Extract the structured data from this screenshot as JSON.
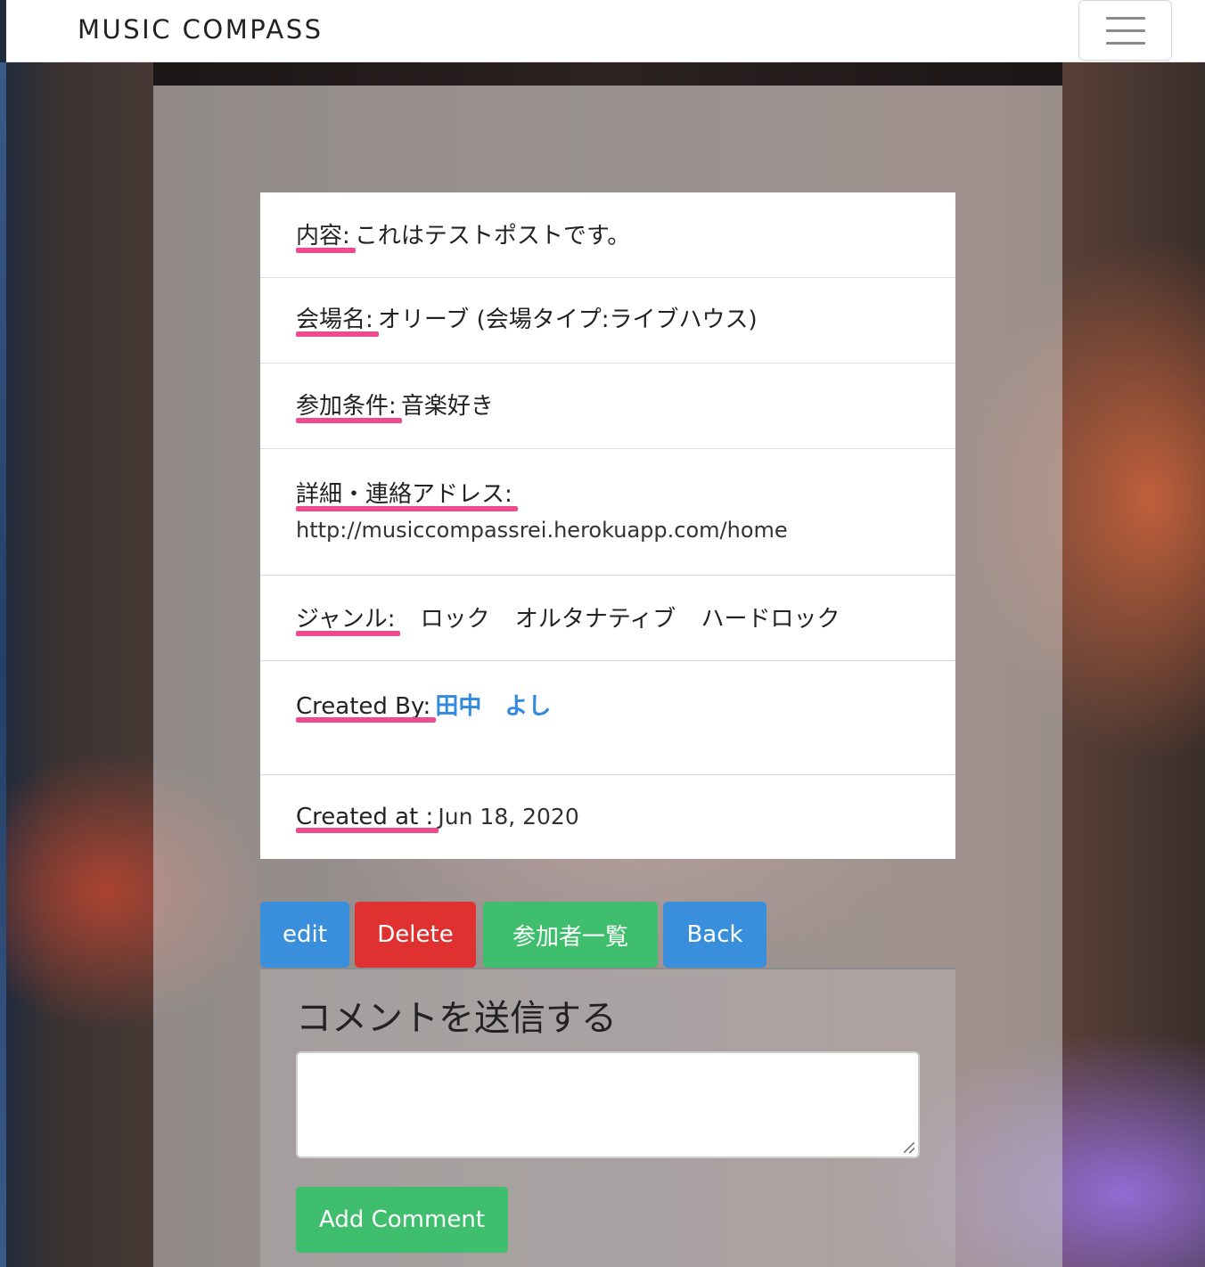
{
  "navbar": {
    "brand": "MUSIC COMPASS",
    "menu_icon": "hamburger-menu-icon"
  },
  "post": {
    "content_label": "内容:",
    "content_value": "これはテストポストです。",
    "venue_label": "会場名:",
    "venue_value": "オリーブ (会場タイプ:ライブハウス)",
    "conditions_label": "参加条件:",
    "conditions_value": "音楽好き",
    "details_label": "詳細・連絡アドレス:",
    "details_value": "http://musiccompassrei.herokuapp.com/home",
    "genre_label": "ジャンル:",
    "genres": [
      "ロック",
      "オルタナティブ",
      "ハードロック"
    ],
    "created_by_label": "Created By:",
    "created_by_value": "田中　よし",
    "created_at_label": "Created at :",
    "created_at_value": "Jun 18, 2020"
  },
  "actions": {
    "edit": "edit",
    "delete": "Delete",
    "participants": "参加者一覧",
    "back": "Back"
  },
  "comment": {
    "title": "コメントを送信する",
    "input_value": "",
    "submit": "Add Comment"
  },
  "colors": {
    "highlight": "#ee4b8f",
    "primary": "#3a8fdc",
    "danger": "#e03131",
    "success": "#3fbf6e",
    "link": "#2f8ae0"
  }
}
